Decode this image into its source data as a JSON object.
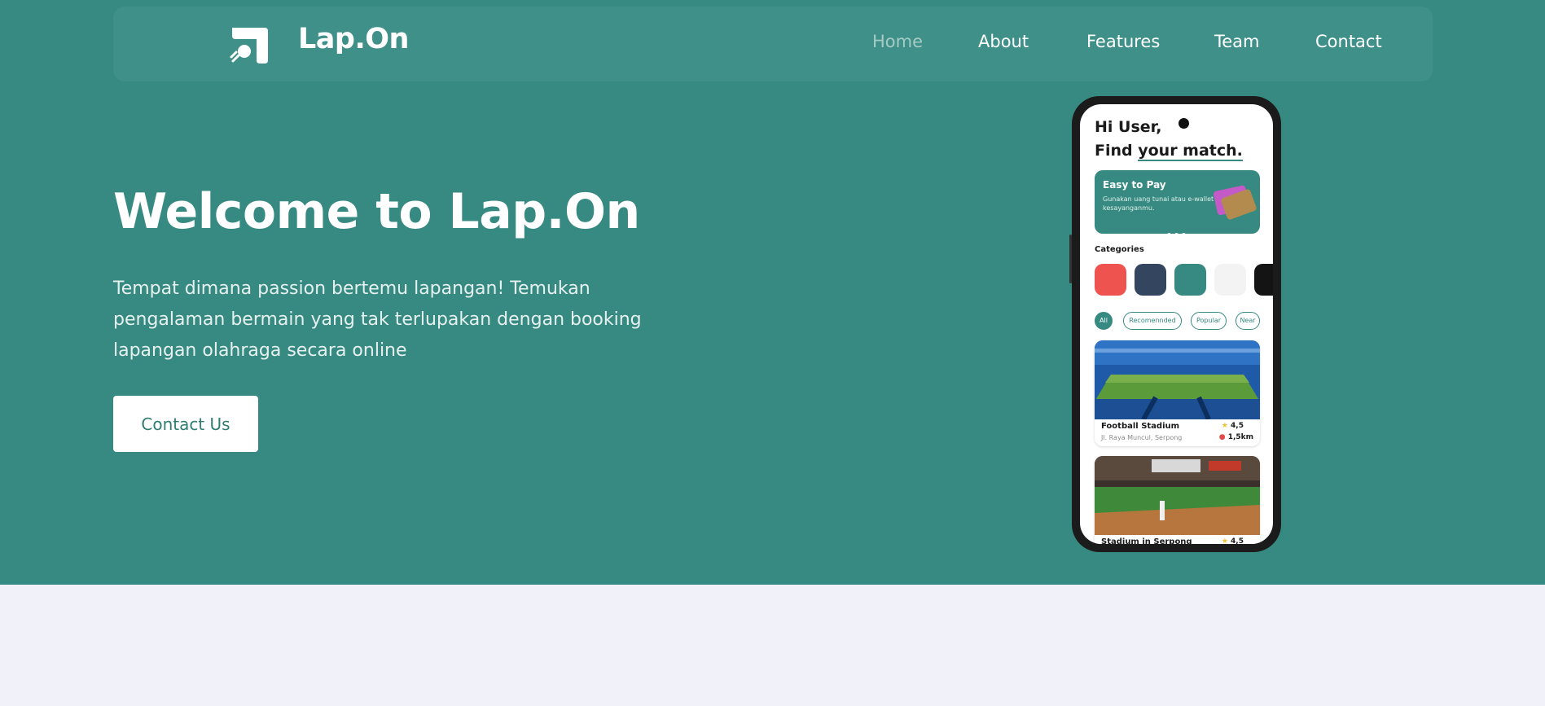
{
  "brand": {
    "name": "Lap.On",
    "logo_icon": "lapon-logo-icon"
  },
  "nav": {
    "items": [
      {
        "label": "Home",
        "active": true
      },
      {
        "label": "About",
        "active": false
      },
      {
        "label": "Features",
        "active": false
      },
      {
        "label": "Team",
        "active": false
      },
      {
        "label": "Contact",
        "active": false
      }
    ]
  },
  "hero": {
    "title": "Welcome to Lap.On",
    "description": "Tempat dimana passion bertemu lapangan! Temukan pengalaman bermain yang tak terlupakan dengan booking lapangan olahraga secara online",
    "cta_label": "Contact Us"
  },
  "phone": {
    "greeting_line1": "Hi User,",
    "greeting_prefix": "Find ",
    "greeting_highlight": "your match.",
    "promo": {
      "title": "Easy to Pay",
      "subtitle": "Gunakan uang tunai atau e-wallet kesayanganmu."
    },
    "categories_label": "Categories",
    "category_colors": [
      "#ef5350",
      "#34455f",
      "#378a81",
      "#f3f3f3",
      "#141414"
    ],
    "chips": [
      "All",
      "Recomennded",
      "Popular",
      "Near"
    ],
    "stadiums": [
      {
        "name": "Football Stadium",
        "address": "Jl. Raya Muncul, Serpong",
        "rating": "4,5",
        "distance": "1,5km"
      },
      {
        "name": "Stadium in Serpong",
        "rating": "4,5"
      }
    ]
  },
  "colors": {
    "hero_bg": "#378a81",
    "navbar_bg": "#3f9088",
    "page_bg": "#f1f1fa",
    "nav_active": "#a5cbc6",
    "cta_text": "#2f7d75"
  }
}
